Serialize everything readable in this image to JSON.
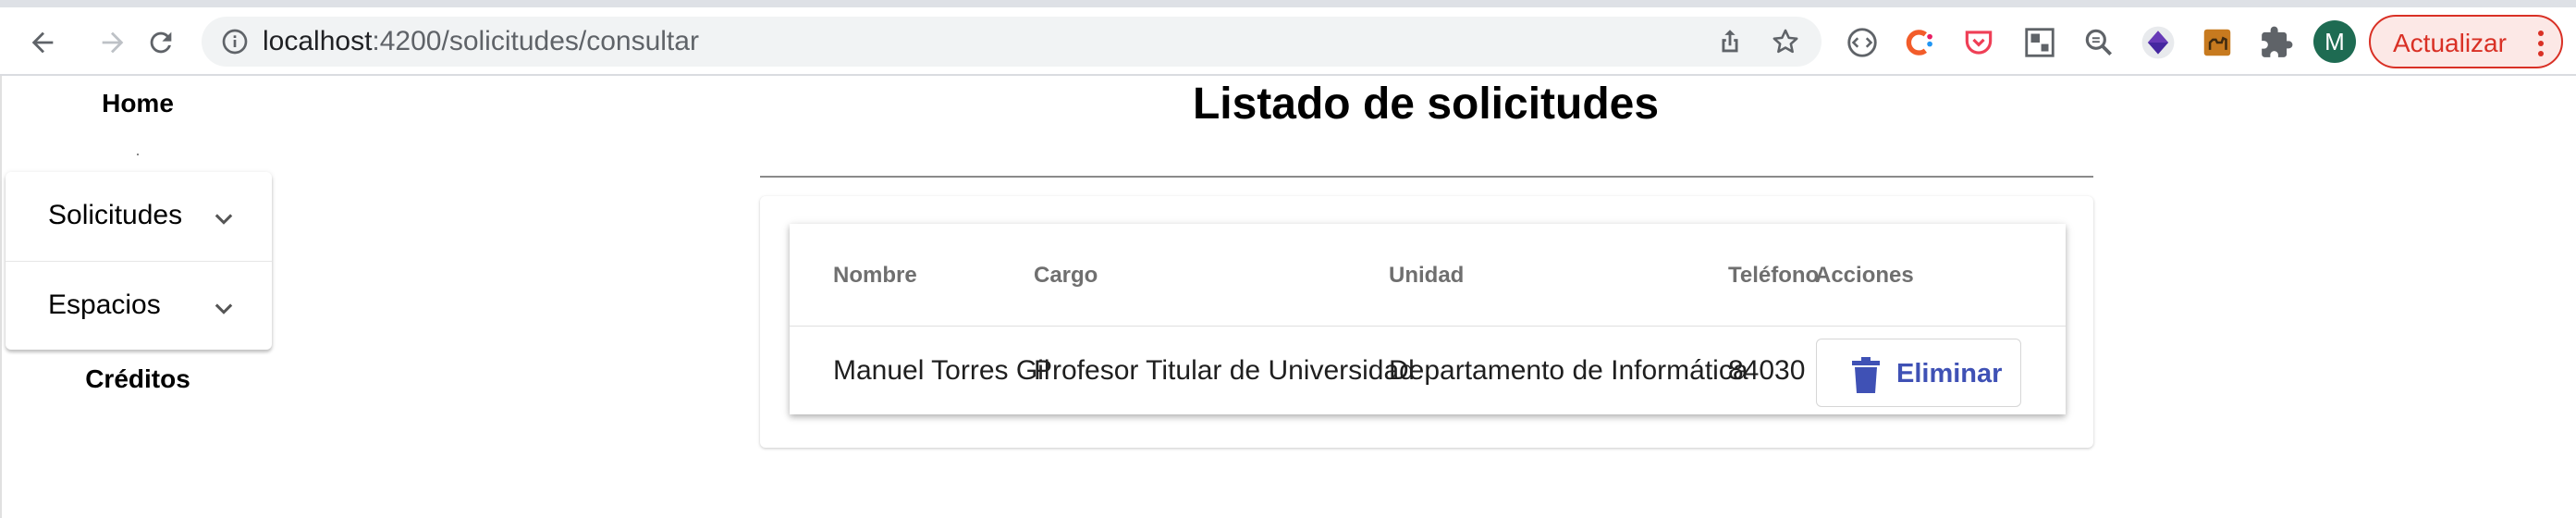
{
  "browser": {
    "url_host": "localhost",
    "url_path": ":4200/solicitudes/consultar",
    "profile_initial": "M",
    "update_button_label": "Actualizar",
    "accent_update": "#d93025"
  },
  "sidebar": {
    "home_label": "Home",
    "menu_items": [
      {
        "label": "Solicitudes",
        "icon": "chevron-down-icon"
      },
      {
        "label": "Espacios",
        "icon": "chevron-down-icon"
      }
    ],
    "credits_label": "Créditos"
  },
  "page": {
    "title": "Listado de solicitudes"
  },
  "table": {
    "headers": [
      "Nombre",
      "Cargo",
      "Unidad",
      "Teléfono",
      "Acciones"
    ],
    "rows": [
      {
        "nombre": "Manuel Torres Gil",
        "cargo": "Profesor Titular de Universidad",
        "unidad": "Departamento de Informática",
        "telefono": "84030",
        "action_label": "Eliminar",
        "action_icon": "trash-icon"
      }
    ],
    "action_color": "#3f51b5"
  }
}
